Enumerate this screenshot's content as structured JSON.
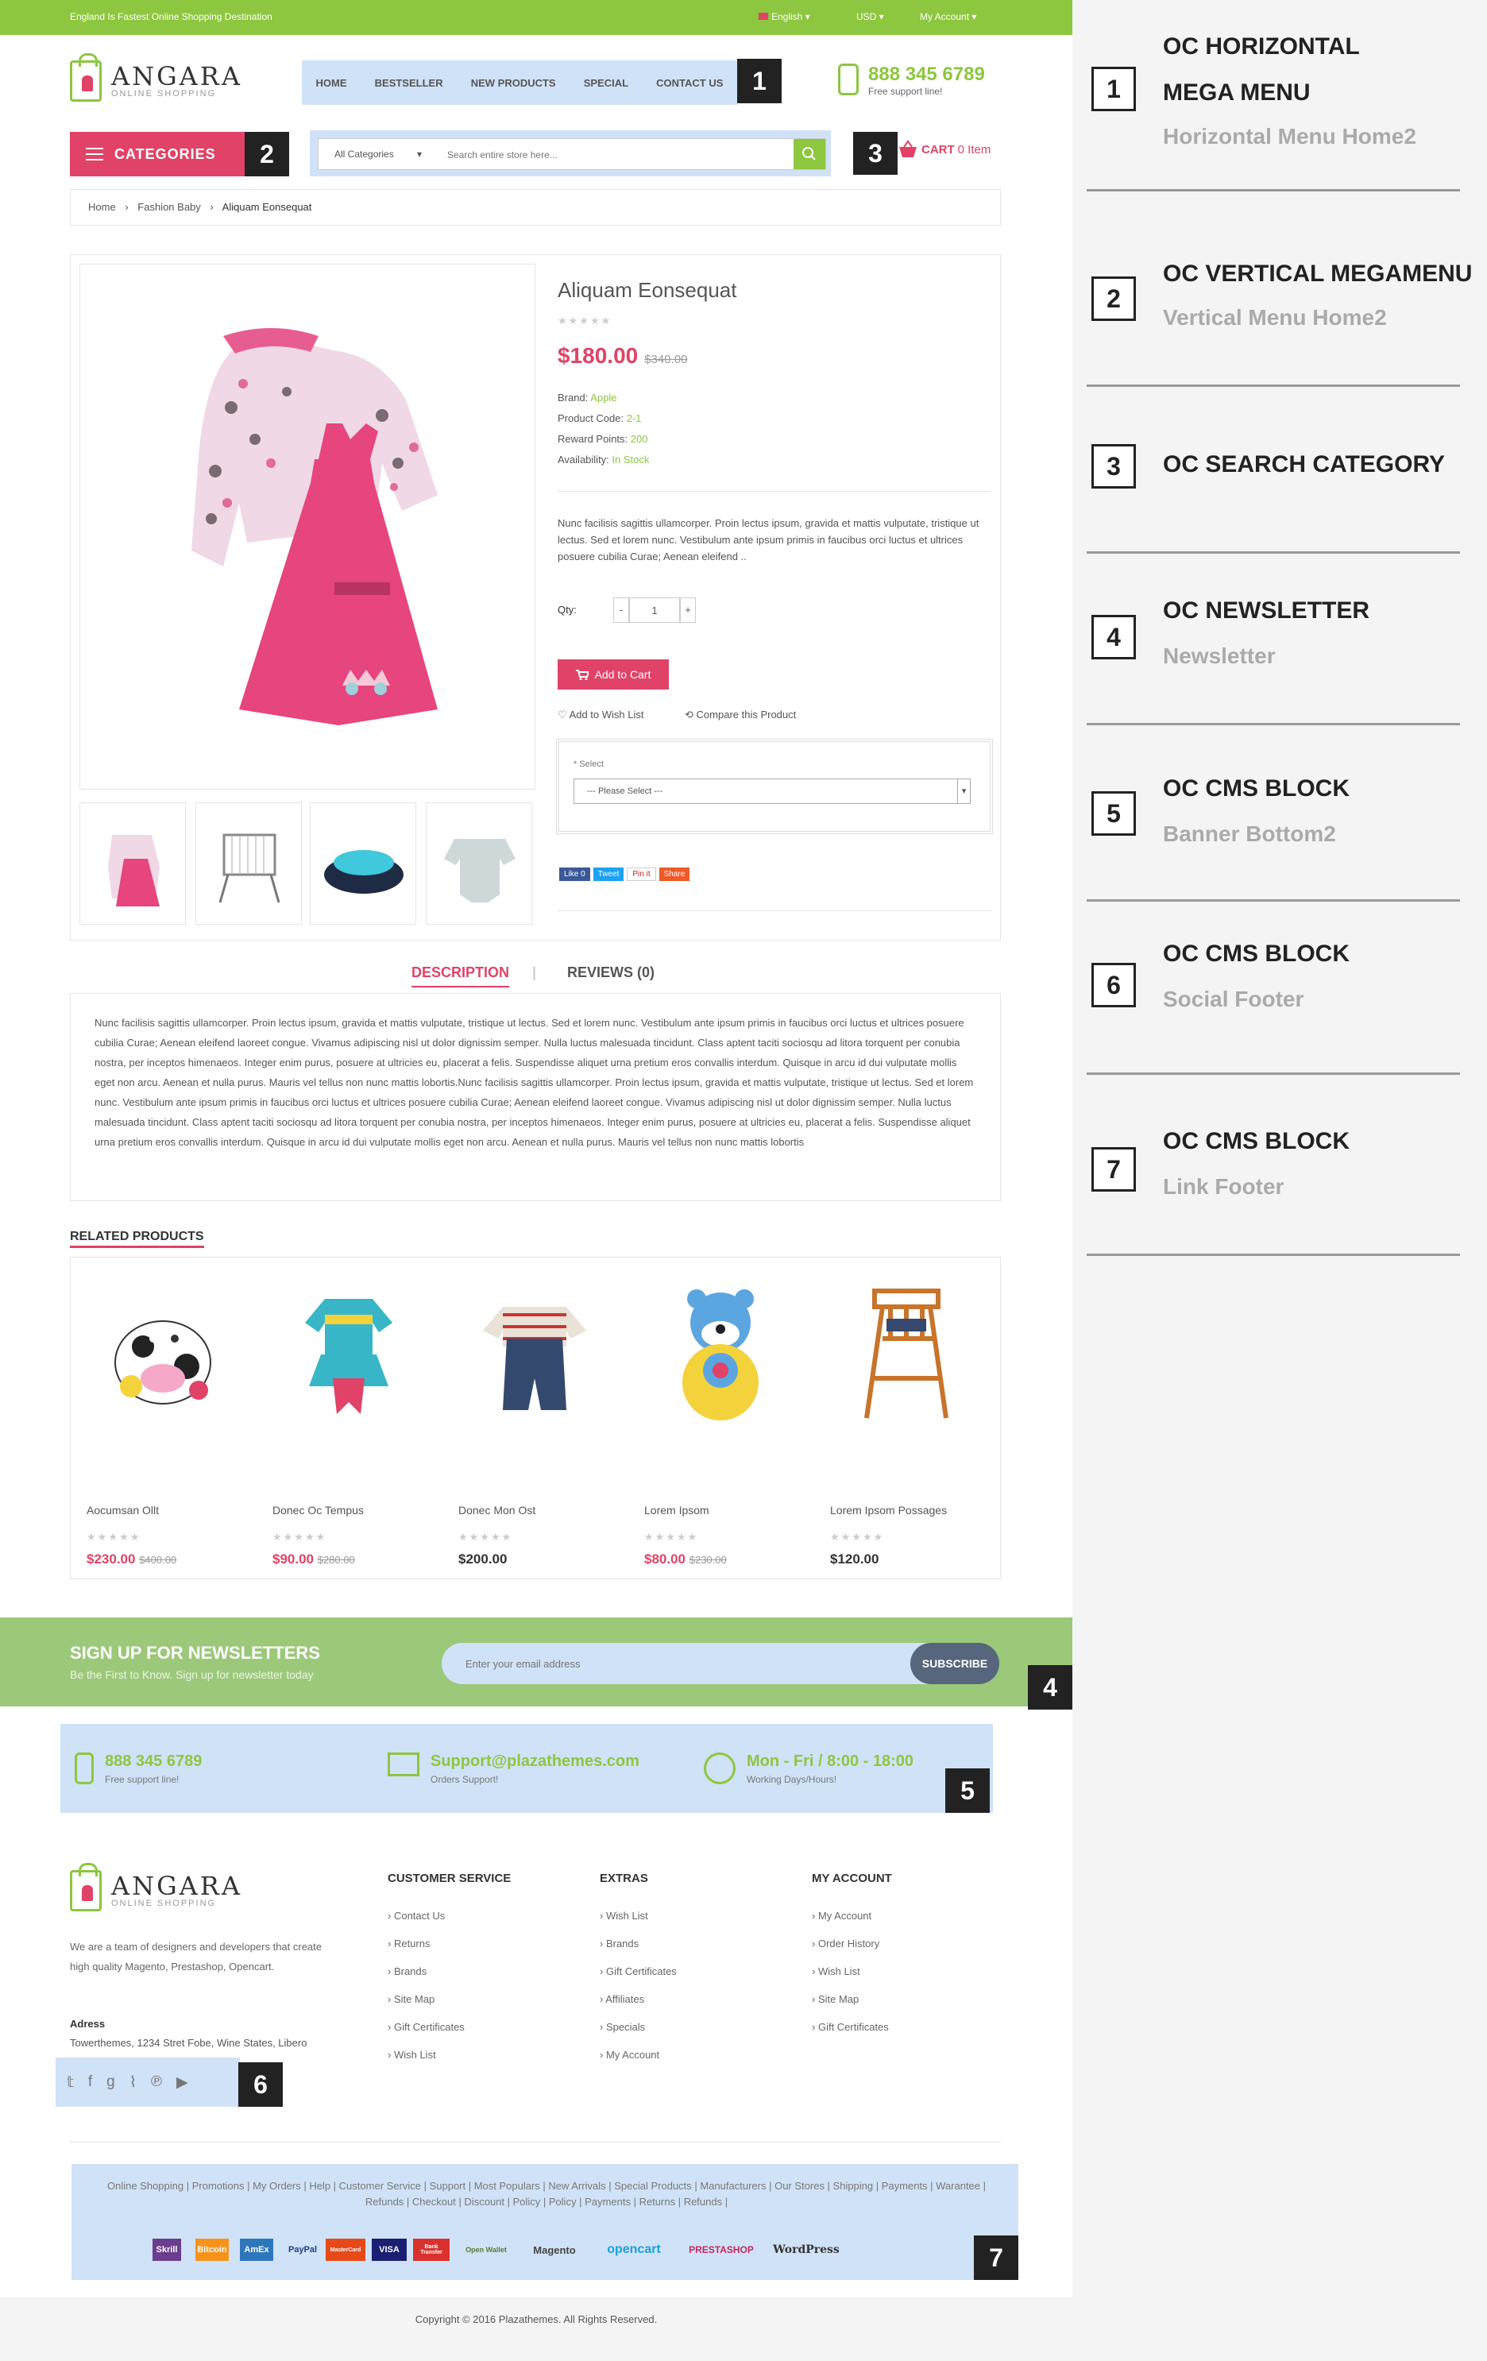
{
  "topbar": {
    "promo": "England Is Fastest Online Shopping Destination",
    "language": "English",
    "currency": "USD",
    "account": "My Account"
  },
  "logo": {
    "name": "ANGARA",
    "sub": "ONLINE SHOPPING"
  },
  "menu": {
    "items": [
      "HOME",
      "BESTSELLER",
      "NEW PRODUCTS",
      "SPECIAL",
      "CONTACT US"
    ]
  },
  "phone": {
    "number": "888 345 6789",
    "label": "Free support line!"
  },
  "categories": {
    "label": "CATEGORIES"
  },
  "search": {
    "category": "All Categories",
    "placeholder": "Search entire store here..."
  },
  "cart": {
    "label": "CART",
    "count": "0 Item"
  },
  "breadcrumb": [
    "Home",
    "Fashion Baby",
    "Aliquam Eonsequat"
  ],
  "product": {
    "name": "Aliquam Eonsequat",
    "price": "$180.00",
    "old_price": "$340.00",
    "brand_label": "Brand:",
    "brand": "Apple",
    "code_label": "Product Code:",
    "code": "2-1",
    "points_label": "Reward Points:",
    "points": "200",
    "avail_label": "Availability:",
    "avail": "In Stock",
    "short_desc": "Nunc facilisis sagittis ullamcorper. Proin lectus ipsum, gravida et mattis vulputate, tristique ut lectus. Sed et lorem nunc. Vestibulum ante ipsum primis in faucibus orci luctus et ultrices posuere cubilia Curae; Aenean eleifend ..",
    "qty_label": "Qty:",
    "qty": "1",
    "minus": "-",
    "plus": "+",
    "add_to_cart": "Add to Cart",
    "wishlist": "Add to Wish List",
    "compare": "Compare this Product",
    "select_label": "* Select",
    "select_value": "--- Please Select ---",
    "share": [
      "Like 0",
      "Tweet",
      "Pin it",
      "Share"
    ]
  },
  "tabs": {
    "description": "DESCRIPTION",
    "reviews": "REVIEWS (0)"
  },
  "description": "Nunc facilisis sagittis ullamcorper. Proin lectus ipsum, gravida et mattis vulputate, tristique ut lectus. Sed et lorem nunc. Vestibulum ante ipsum primis in faucibus orci luctus et ultrices posuere cubilia Curae; Aenean eleifend laoreet congue. Vivamus adipiscing nisl ut dolor dignissim semper. Nulla luctus malesuada tincidunt. Class aptent taciti sociosqu ad litora torquent per conubia nostra, per inceptos himenaeos. Integer enim purus, posuere at ultricies eu, placerat a felis. Suspendisse aliquet urna pretium eros convallis interdum. Quisque in arcu id dui vulputate mollis eget non arcu. Aenean et nulla purus. Mauris vel tellus non nunc mattis lobortis.Nunc facilisis sagittis ullamcorper. Proin lectus ipsum, gravida et mattis vulputate, tristique ut lectus. Sed et lorem nunc. Vestibulum ante ipsum primis in faucibus orci luctus et ultrices posuere cubilia Curae; Aenean eleifend laoreet congue. Vivamus adipiscing nisl ut dolor dignissim semper. Nulla luctus malesuada tincidunt. Class aptent taciti sociosqu ad litora torquent per conubia nostra, per inceptos himenaeos. Integer enim purus, posuere at ultricies eu, placerat a felis. Suspendisse aliquet urna pretium eros convallis interdum. Quisque in arcu id dui vulputate mollis eget non arcu. Aenean et nulla purus. Mauris vel tellus non nunc mattis lobortis",
  "related": {
    "title": "RELATED PRODUCTS",
    "items": [
      {
        "name": "Aocumsan Ollt",
        "price": "$230.00",
        "old": "$400.00"
      },
      {
        "name": "Donec Oc Tempus",
        "price": "$90.00",
        "old": "$280.00"
      },
      {
        "name": "Donec Mon Ost",
        "price": "$200.00",
        "old": ""
      },
      {
        "name": "Lorem Ipsom",
        "price": "$80.00",
        "old": "$230.00"
      },
      {
        "name": "Lorem Ipsom Possages",
        "price": "$120.00",
        "old": ""
      }
    ]
  },
  "newsletter": {
    "title": "SIGN UP FOR NEWSLETTERS",
    "sub": "Be the First to Know. Sign up for newsletter today",
    "placeholder": "Enter your email address",
    "button": "SUBSCRIBE"
  },
  "banner": [
    {
      "a": "888 345 6789",
      "b": "Free support line!"
    },
    {
      "a": "Support@plazathemes.com",
      "b": "Orders Support!"
    },
    {
      "a": "Mon - Fri / 8:00 - 18:00",
      "b": "Working Days/Hours!"
    }
  ],
  "footer": {
    "about": "We are a team of designers and developers that create high quality Magento, Prestashop, Opencart.",
    "address_label": "Adress",
    "address": "Towerthemes, 1234 Stret Fobe, Wine States, Libero",
    "cols": [
      {
        "title": "CUSTOMER SERVICE",
        "links": [
          "Contact Us",
          "Returns",
          "Brands",
          "Site Map",
          "Gift Certificates",
          "Wish List"
        ]
      },
      {
        "title": "EXTRAS",
        "links": [
          "Wish List",
          "Brands",
          "Gift Certificates",
          "Affiliates",
          "Specials",
          "My Account"
        ]
      },
      {
        "title": "MY ACCOUNT",
        "links": [
          "My Account",
          "Order History",
          "Wish List",
          "Site Map",
          "Gift Certificates"
        ]
      }
    ],
    "bottom_links": "Online Shopping | Promotions | My Orders | Help | Customer Service | Support | Most Populars | New Arrivals | Special Products | Manufacturers | Our Stores | Shipping | Payments | Warantee | Refunds | Checkout | Discount | Policy | Policy | Payments | Returns | Refunds |",
    "payments": [
      "Skrill",
      "Bitcoin",
      "AmEx",
      "PayPal",
      "MasterCard",
      "VISA",
      "Bank Transfer",
      "Open Wallet",
      "Magento",
      "opencart",
      "PRESTASHOP",
      "WordPress"
    ],
    "copyright": "Copyright © 2016 Plazathemes. All Rights Reserved."
  },
  "annotations": [
    {
      "num": "1",
      "t1": "OC HORIZONTAL",
      "t1b": "MEGA MENU",
      "t2": "Horizontal Menu Home2"
    },
    {
      "num": "2",
      "t1": "OC VERTICAL MEGAMENU",
      "t2": "Vertical Menu Home2"
    },
    {
      "num": "3",
      "t1": "OC SEARCH CATEGORY",
      "t2": ""
    },
    {
      "num": "4",
      "t1": "OC NEWSLETTER",
      "t2": "Newsletter"
    },
    {
      "num": "5",
      "t1": "OC CMS BLOCK",
      "t2": "Banner Bottom2"
    },
    {
      "num": "6",
      "t1": "OC CMS BLOCK",
      "t2": "Social Footer"
    },
    {
      "num": "7",
      "t1": "OC CMS BLOCK",
      "t2": "Link Footer"
    }
  ],
  "badges": [
    "1",
    "2",
    "3",
    "4",
    "5",
    "6",
    "7"
  ],
  "colors": {
    "accent": "#8dc63f",
    "pink": "#e04367",
    "highlight": "#d0e2f7",
    "newsletter": "#9cc87a"
  }
}
